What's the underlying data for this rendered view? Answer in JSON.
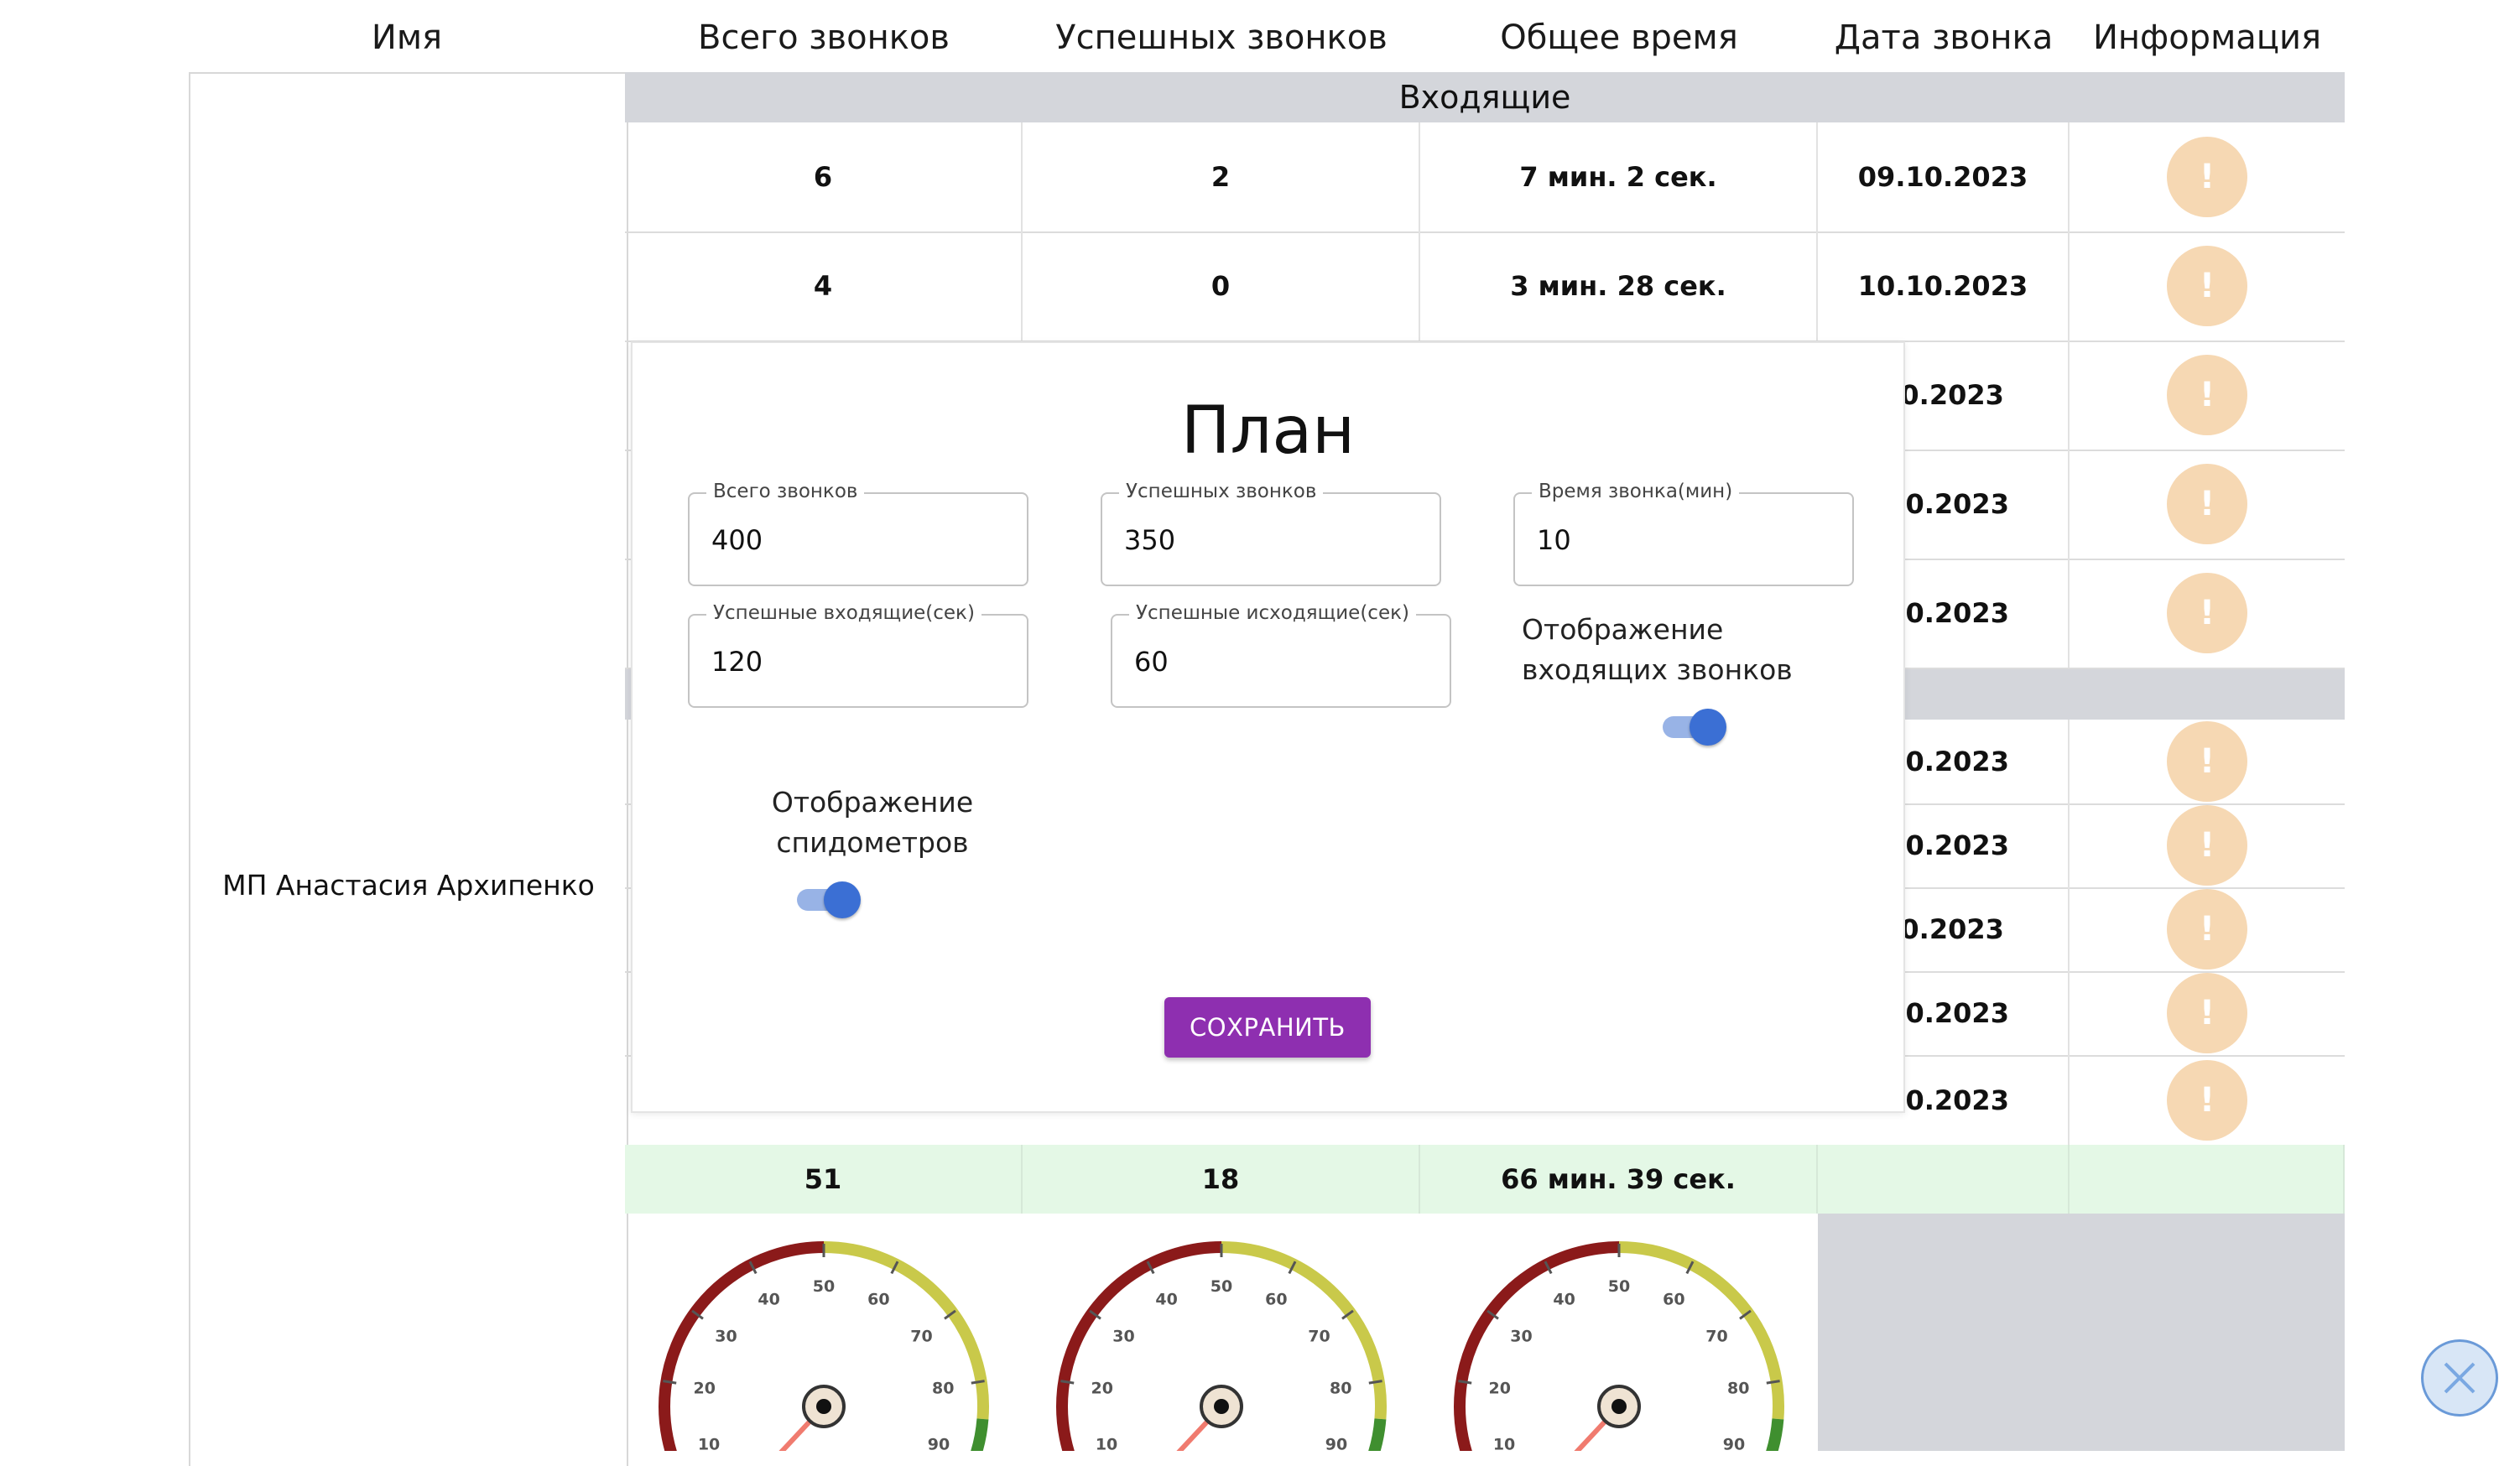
{
  "columns": [
    "Имя",
    "Всего звонков",
    "Успешных звонков",
    "Общее время",
    "Дата звонка",
    "Информация"
  ],
  "employee_name": "МП Анастасия Архипенко",
  "incoming_group": "Входящие",
  "rows": [
    {
      "total": "6",
      "success": "2",
      "time": "7 мин. 2 сек.",
      "date": "09.10.2023"
    },
    {
      "total": "4",
      "success": "0",
      "time": "3 мин. 28 сек.",
      "date": "10.10.2023"
    },
    {
      "date": "10.2023"
    },
    {
      "date": ".10.2023"
    },
    {
      "date": ".10.2023"
    },
    {
      "date": ".10.2023"
    },
    {
      "date": ".10.2023"
    },
    {
      "date": "10.2023"
    },
    {
      "date": ".10.2023"
    },
    {
      "date": ".10.2023"
    }
  ],
  "info_icon": "!",
  "totals": {
    "total": "51",
    "success": "18",
    "time": "66 мин. 39 сек."
  },
  "gauge": {
    "ticks": [
      "10",
      "20",
      "30",
      "40",
      "50",
      "60",
      "70",
      "80",
      "90"
    ]
  },
  "modal": {
    "title": "План",
    "fields": {
      "total_calls": {
        "label": "Всего звонков",
        "value": "400"
      },
      "success_calls": {
        "label": "Успешных звонков",
        "value": "350"
      },
      "call_time": {
        "label": "Время звонка(мин)",
        "value": "10"
      },
      "success_incoming": {
        "label": "Успешные входящие(сек)",
        "value": "120"
      },
      "success_outgoing": {
        "label": "Успешные исходящие(сек)",
        "value": "60"
      }
    },
    "toggle_incoming": {
      "label_line1": "Отображение",
      "label_line2": "входящих звонков",
      "on": true
    },
    "toggle_speedometers": {
      "label_line1": "Отображение",
      "label_line2": "спидометров",
      "on": true
    },
    "save_label": "СОХРАНИТЬ"
  },
  "colors": {
    "accent": "#8e2fb0",
    "toggle": "#3b6fd4",
    "info": "#f6d8b3",
    "group_bg": "#d4d6db",
    "total_bg": "#e4f8e6",
    "gauge_red": "#8b1a1a",
    "gauge_yellow": "#c9c94a",
    "gauge_green": "#3f8f2f",
    "needle": "#f07b6f"
  }
}
